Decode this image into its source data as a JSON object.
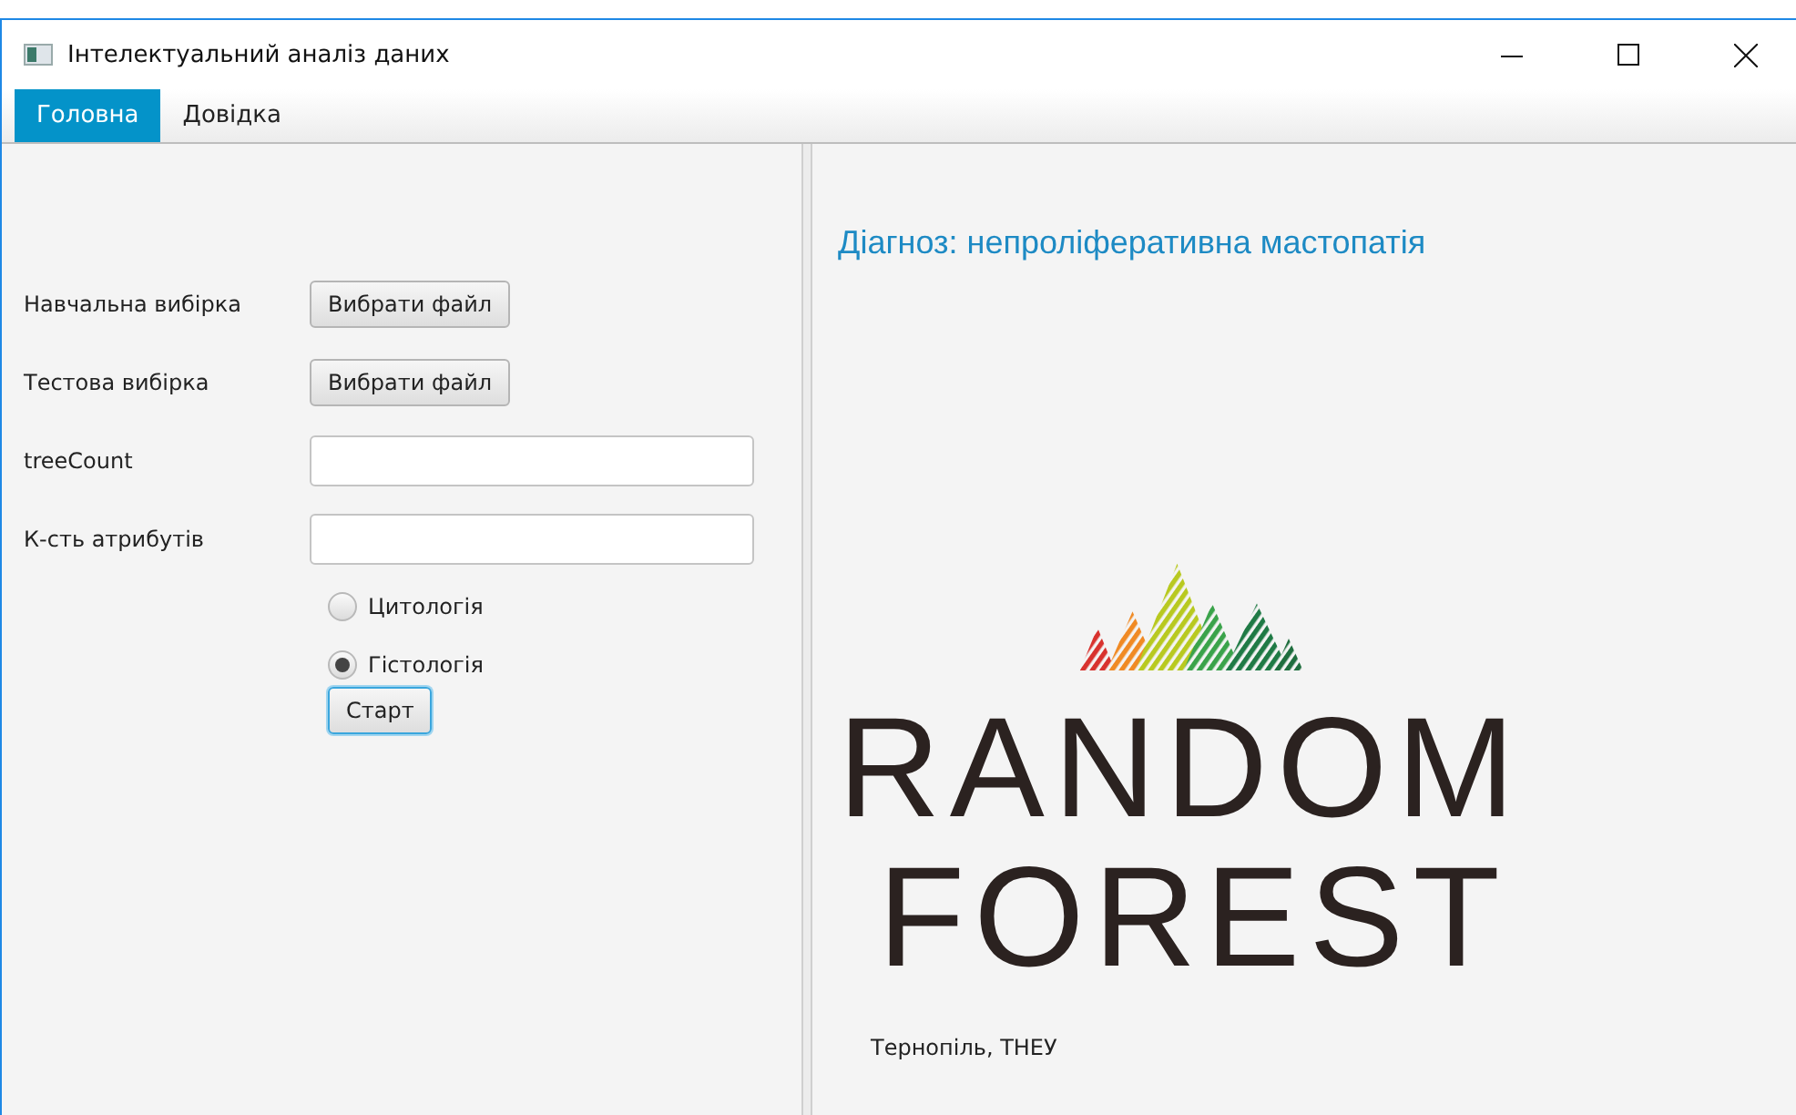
{
  "window": {
    "title": "Інтелектуальний аналіз даних"
  },
  "menu": [
    {
      "label": "Головна",
      "selected": true
    },
    {
      "label": "Довідка",
      "selected": false
    }
  ],
  "form": [
    {
      "kind": "file",
      "label": "Навчальна вибірка",
      "button": "Вибрати файл"
    },
    {
      "kind": "file",
      "label": "Тестова вибірка",
      "button": "Вибрати файл"
    },
    {
      "kind": "text",
      "label": "treeCount"
    },
    {
      "kind": "text",
      "label": "К-сть атрибутів"
    }
  ],
  "radios": [
    {
      "label": "Цитологія",
      "selected": false
    },
    {
      "label": "Гістологія",
      "selected": true
    }
  ],
  "start_button": "Старт",
  "diagnosis": "Діагноз: непроліферативна мастопатія",
  "logo": [
    "RANDOM",
    "FOREST"
  ],
  "footer": "Тернопіль, ТНЕУ"
}
